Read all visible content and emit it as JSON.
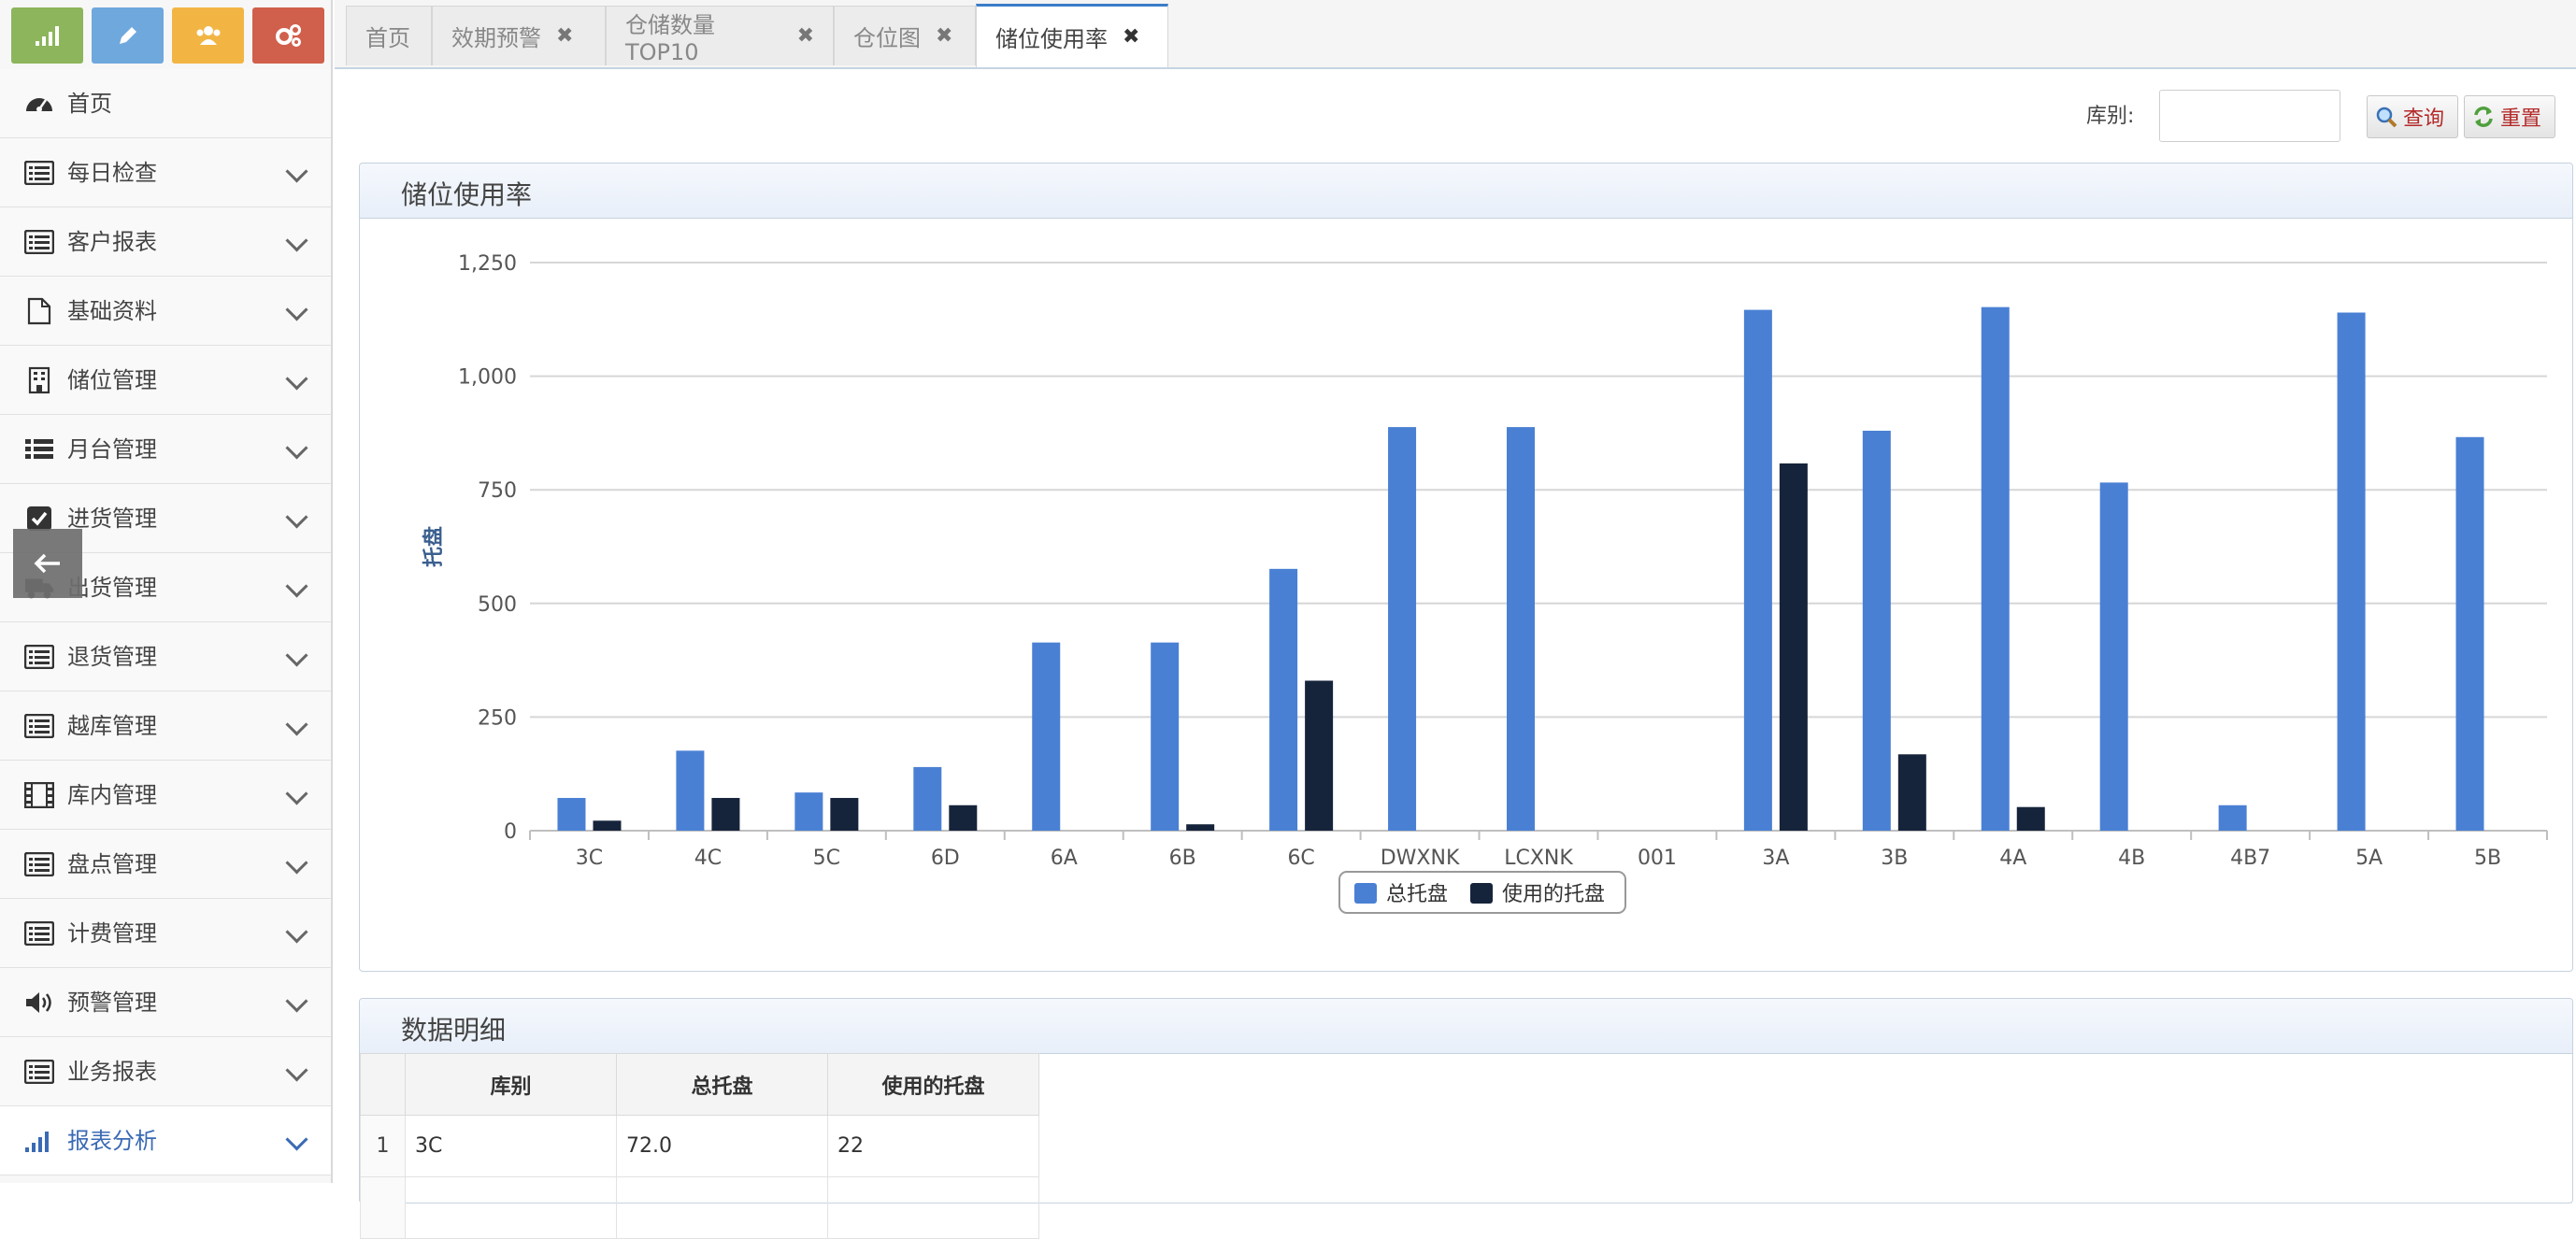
{
  "sidebar": {
    "shortcuts": [
      {
        "icon": "signal-bars-icon",
        "color": "#8cb55c"
      },
      {
        "icon": "pencil-icon",
        "color": "#6fa8dd"
      },
      {
        "icon": "users-icon",
        "color": "#f2b544"
      },
      {
        "icon": "gears-icon",
        "color": "#d0604b"
      }
    ],
    "items": [
      {
        "label": "首页",
        "icon": "dashboard-icon",
        "has_submenu": false
      },
      {
        "label": "每日检查",
        "icon": "list-icon",
        "has_submenu": true
      },
      {
        "label": "客户报表",
        "icon": "list-icon",
        "has_submenu": true
      },
      {
        "label": "基础资料",
        "icon": "document-icon",
        "has_submenu": true
      },
      {
        "label": "储位管理",
        "icon": "building-icon",
        "has_submenu": true
      },
      {
        "label": "月台管理",
        "icon": "bullet-list-icon",
        "has_submenu": true
      },
      {
        "label": "进货管理",
        "icon": "checkbox-icon",
        "has_submenu": true
      },
      {
        "label": "出货管理",
        "icon": "truck-icon",
        "has_submenu": true
      },
      {
        "label": "退货管理",
        "icon": "list-icon",
        "has_submenu": true
      },
      {
        "label": "越库管理",
        "icon": "list-icon",
        "has_submenu": true
      },
      {
        "label": "库内管理",
        "icon": "film-icon",
        "has_submenu": true
      },
      {
        "label": "盘点管理",
        "icon": "list-icon",
        "has_submenu": true
      },
      {
        "label": "计费管理",
        "icon": "list-icon",
        "has_submenu": true
      },
      {
        "label": "预警管理",
        "icon": "volume-icon",
        "has_submenu": true
      },
      {
        "label": "业务报表",
        "icon": "list-icon",
        "has_submenu": true
      },
      {
        "label": "报表分析",
        "icon": "signal-bars-icon",
        "has_submenu": true,
        "active": true
      }
    ]
  },
  "tabs": [
    {
      "label": "首页",
      "closable": false
    },
    {
      "label": "效期预警",
      "closable": true
    },
    {
      "label": "仓储数量TOP10",
      "closable": true
    },
    {
      "label": "仓位图",
      "closable": true
    },
    {
      "label": "储位使用率",
      "closable": true,
      "active": true
    }
  ],
  "toolbar": {
    "warehouse_label": "库别:",
    "warehouse_value": "",
    "query_label": "查询",
    "reset_label": "重置"
  },
  "chart_panel": {
    "title": "储位使用率"
  },
  "chart_data": {
    "type": "bar",
    "title": "",
    "ylabel": "托盘",
    "xlabel": "",
    "ylim": [
      0,
      1250
    ],
    "yticks": [
      "0",
      "250",
      "500",
      "750",
      "1,000",
      "1,250"
    ],
    "grid": true,
    "legend_position": "bottom-center",
    "categories": [
      "3C",
      "4C",
      "5C",
      "6D",
      "6A",
      "6B",
      "6C",
      "DWXNK",
      "LCXNK",
      "001",
      "3A",
      "3B",
      "4A",
      "4B",
      "4B7",
      "5A",
      "5B"
    ],
    "series": [
      {
        "name": "总托盘",
        "color": "#4a80d4",
        "values": [
          72,
          176,
          84,
          140,
          414,
          414,
          576,
          888,
          888,
          0,
          1146,
          880,
          1152,
          766,
          56,
          1140,
          866
        ]
      },
      {
        "name": "使用的托盘",
        "color": "#16243b",
        "values": [
          22,
          72,
          72,
          56,
          0,
          14,
          330,
          0,
          0,
          0,
          808,
          168,
          52,
          0,
          0,
          0,
          0
        ]
      }
    ]
  },
  "table_panel": {
    "title": "数据明细",
    "columns": [
      "库别",
      "总托盘",
      "使用的托盘"
    ],
    "rows": [
      {
        "index": "1",
        "cells": [
          "3C",
          "72.0",
          "22"
        ]
      }
    ]
  }
}
